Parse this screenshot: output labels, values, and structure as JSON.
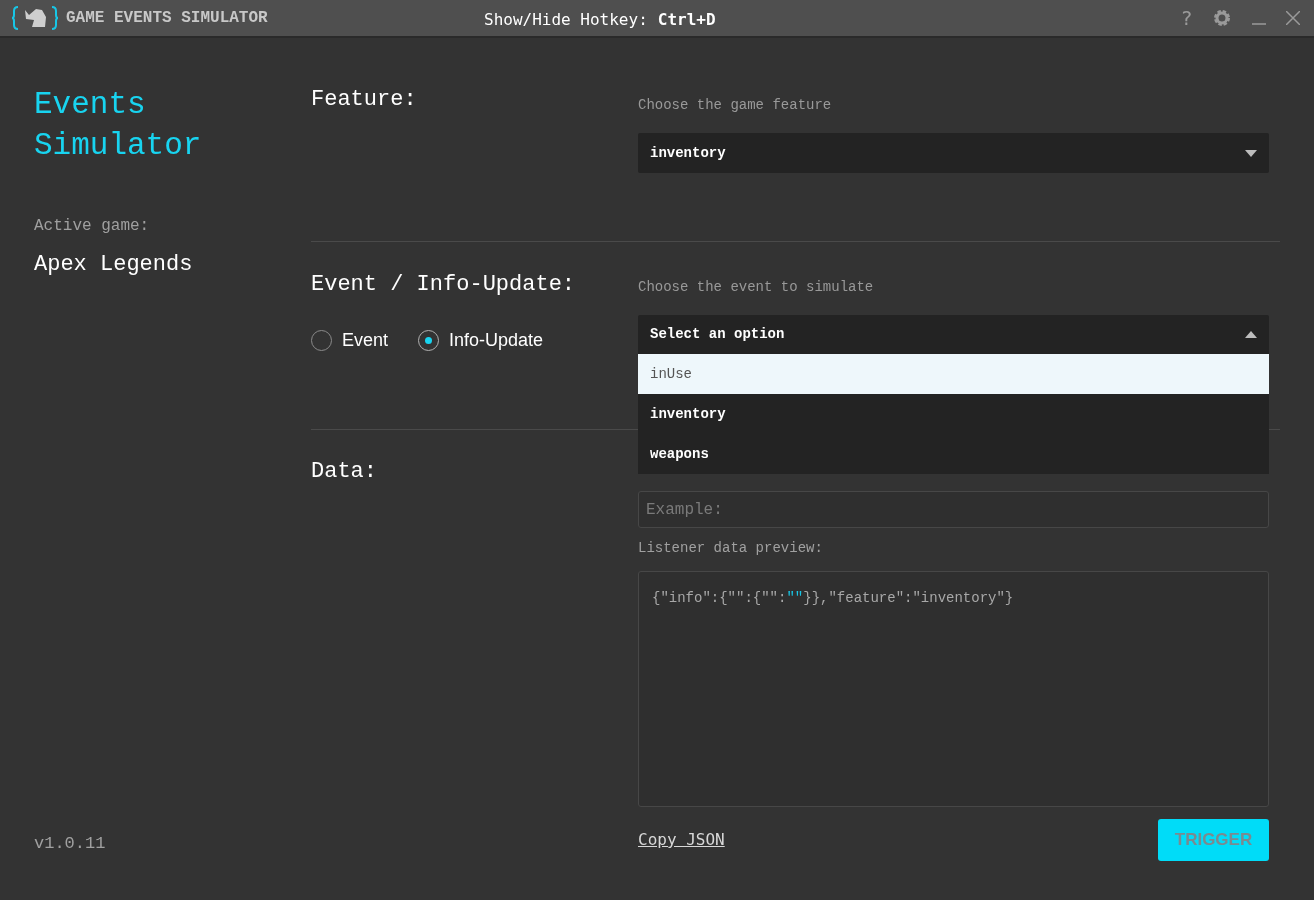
{
  "window": {
    "title": "GAME EVENTS SIMULATOR",
    "hotkey_label": "Show/Hide Hotkey:",
    "hotkey": "Ctrl+D",
    "help": "?"
  },
  "sidebar": {
    "title": "Events Simulator",
    "active_game_label": "Active game:",
    "active_game": "Apex Legends",
    "version": "v1.0.11"
  },
  "feature": {
    "heading": "Feature:",
    "hint": "Choose the game feature",
    "value": "inventory",
    "expanded": false
  },
  "event": {
    "heading": "Event / Info-Update:",
    "hint": "Choose the event to simulate",
    "radios": [
      {
        "label": "Event",
        "selected": false
      },
      {
        "label": "Info-Update",
        "selected": true
      }
    ],
    "select": {
      "value": "Select an option",
      "expanded": true,
      "options": [
        {
          "label": "inUse",
          "highlighted": true
        },
        {
          "label": "inventory",
          "highlighted": false
        },
        {
          "label": "weapons",
          "highlighted": false
        }
      ]
    }
  },
  "data": {
    "heading": "Data:",
    "placeholder": "Example:",
    "preview_label": "Listener data preview:",
    "preview": [
      {
        "text": "{\"info\":{\"\":{\"\":",
        "kind": "plain"
      },
      {
        "text": "\"\"",
        "kind": "highlight"
      },
      {
        "text": "}},\"feature\":\"inventory\"}",
        "kind": "plain"
      }
    ],
    "copy_link": "Copy JSON",
    "trigger": "TRIGGER"
  }
}
